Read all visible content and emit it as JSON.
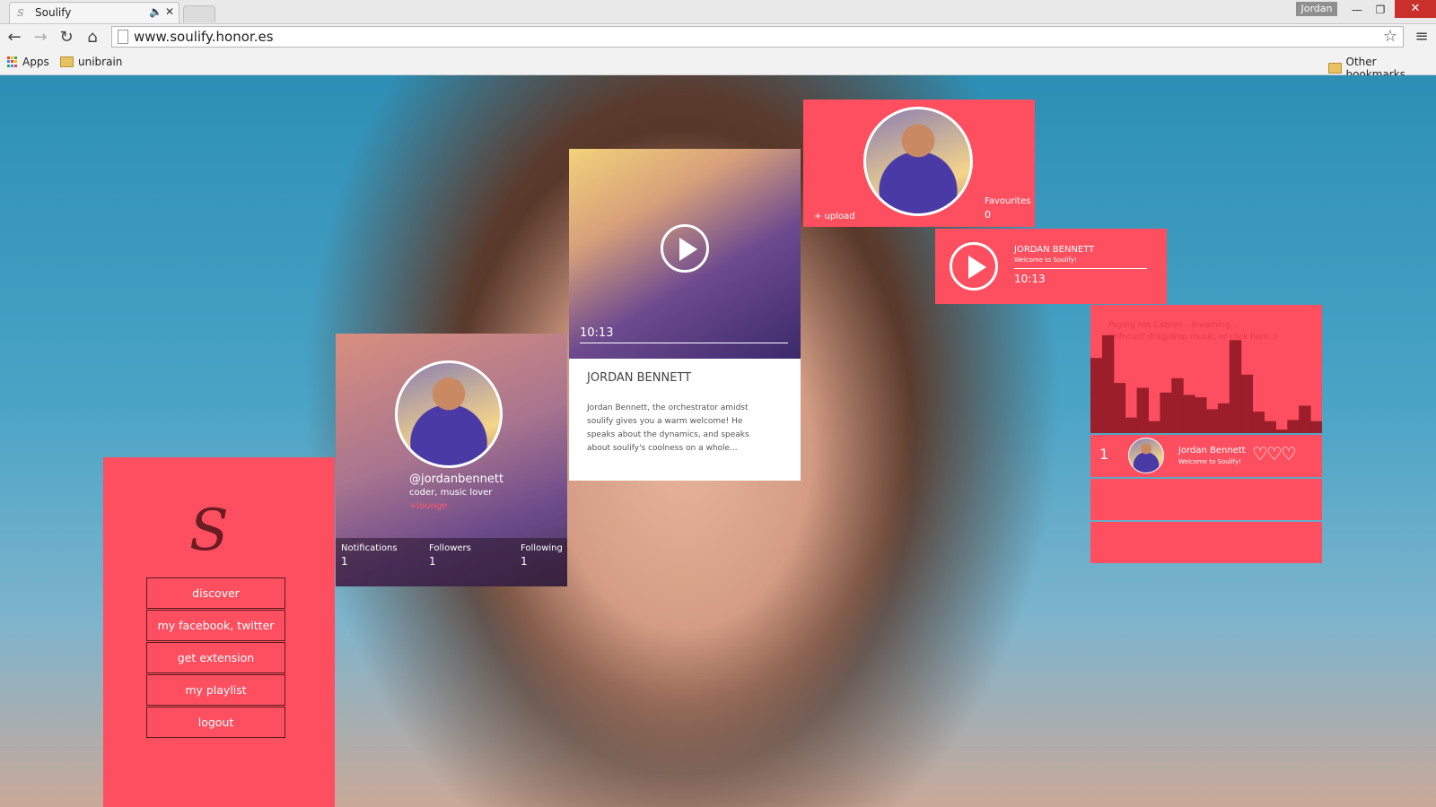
{
  "browser": {
    "tab_title": "Soulify",
    "tab_favicon": "S",
    "tab_sound_icon": "speaker-icon",
    "tab_close": "✕",
    "user_badge": "Jordan",
    "url": "www.soulify.honor.es",
    "bookmarks": {
      "apps": "Apps",
      "folder": "unibrain",
      "other": "Other bookmarks"
    }
  },
  "sidebar": {
    "logo": "S",
    "links": [
      "discover",
      "my facebook, twitter",
      "get extension",
      "my playlist",
      "logout"
    ]
  },
  "profile": {
    "handle": "@jordanbennett",
    "bio": "coder, music lover",
    "lounge": "+lounge",
    "stats": [
      {
        "label": "Notifications",
        "value": "1"
      },
      {
        "label": "Followers",
        "value": "1"
      },
      {
        "label": "Following",
        "value": "1"
      }
    ]
  },
  "video": {
    "time": "10:13",
    "title": "JORDAN BENNETT",
    "description": "Jordan Bennett, the orchestrator amidst soulify gives you a warm welcome! He speaks about the dynamics, and speaks about soulify's coolness on a whole..."
  },
  "user_card": {
    "upload": "+ upload",
    "favourites_label": "Favourites",
    "favourites_value": "0"
  },
  "player": {
    "title": "JORDAN BENNETT",
    "subtitle": "Welcome to Soulify!",
    "time": "10:13"
  },
  "visualizer": {
    "caption_1": "Paying hot Cabreri - Breathing...",
    "caption_2": "Unfocus? drag/drop music, or click here :)",
    "bar_color": "#9b1e2a",
    "levels": [
      0.63,
      0.82,
      0.42,
      0.13,
      0.38,
      0.1,
      0.34,
      0.46,
      0.32,
      0.3,
      0.2,
      0.25,
      0.78,
      0.49,
      0.18,
      0.1,
      0.03,
      0.11,
      0.23,
      0.1
    ]
  },
  "playlist": {
    "items": [
      {
        "number": "1",
        "title": "Jordan Bennett",
        "subtitle": "Welcome to Soulify!"
      }
    ]
  },
  "colors": {
    "accent": "#fd4f5f",
    "dark_bar": "#9b1e2a"
  }
}
